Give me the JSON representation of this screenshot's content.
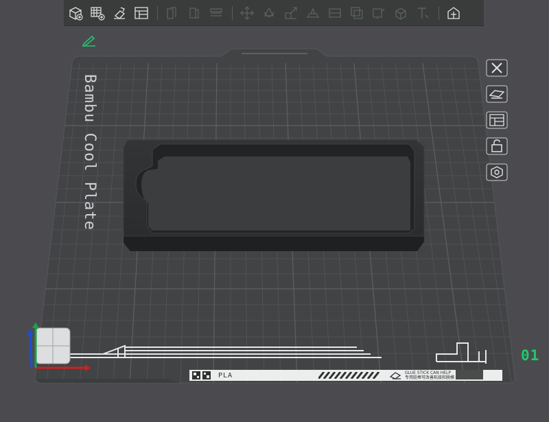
{
  "toolbar": {
    "buttons": [
      {
        "name": "add-object-icon",
        "enabled": true
      },
      {
        "name": "add-plate-icon",
        "enabled": true
      },
      {
        "name": "auto-orient-icon",
        "enabled": true
      },
      {
        "name": "arrange-icon",
        "enabled": true
      },
      {
        "name": "split-objects-icon",
        "enabled": false
      },
      {
        "name": "split-parts-icon",
        "enabled": false
      },
      {
        "name": "layers-icon",
        "enabled": false
      },
      {
        "name": "move-icon",
        "enabled": false
      },
      {
        "name": "rotate-icon",
        "enabled": false
      },
      {
        "name": "scale-icon",
        "enabled": false
      },
      {
        "name": "lay-on-face-icon",
        "enabled": false
      },
      {
        "name": "cut-icon",
        "enabled": false
      },
      {
        "name": "boolean-icon",
        "enabled": false
      },
      {
        "name": "support-paint-icon",
        "enabled": false
      },
      {
        "name": "seam-paint-icon",
        "enabled": false
      },
      {
        "name": "text-icon",
        "enabled": false
      },
      {
        "name": "assembly-icon",
        "enabled": true
      }
    ]
  },
  "plate": {
    "label": "Bambu Cool Plate",
    "number": "01",
    "footer": {
      "material": "PLA",
      "tip_line1": "GLUE STICK CAN HELP",
      "tip_line2": "专用胶棒可改善粘接和脱模"
    }
  },
  "side_tools": [
    {
      "name": "close-icon"
    },
    {
      "name": "plate-settings-icon"
    },
    {
      "name": "arrange-plate-icon"
    },
    {
      "name": "lock-icon"
    },
    {
      "name": "settings-hex-icon"
    }
  ],
  "colors": {
    "background": "#4b4b4f",
    "plate": "#424345",
    "grid": "#525456",
    "object": "#2e2f30",
    "accent": "#1fc86b",
    "axis_x": "#d11f1f",
    "axis_y": "#16a34a",
    "axis_z": "#1d4ed8"
  }
}
